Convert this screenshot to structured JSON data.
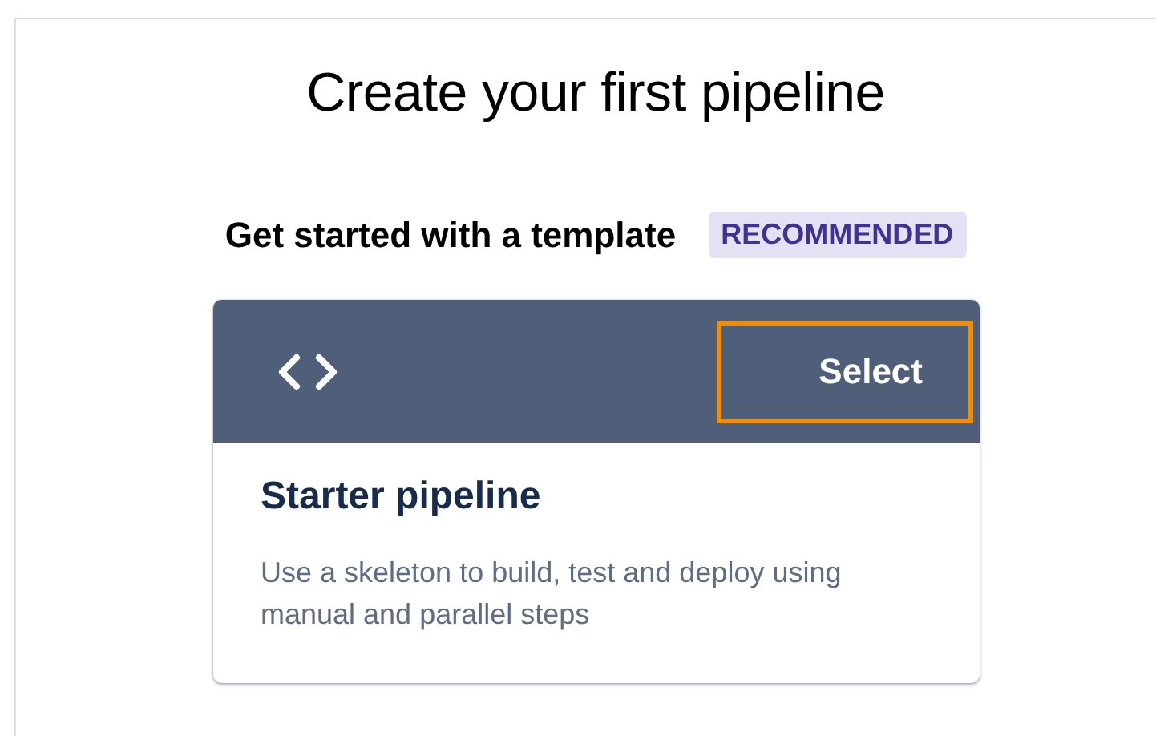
{
  "heading": "Create your first pipeline",
  "section": {
    "title": "Get started with a template",
    "badge": "RECOMMENDED"
  },
  "template_card": {
    "select_button": {
      "label": "Select",
      "highlighted": true
    },
    "title": "Starter pipeline",
    "description": "Use a skeleton to build, test and deploy using manual and parallel steps"
  }
}
